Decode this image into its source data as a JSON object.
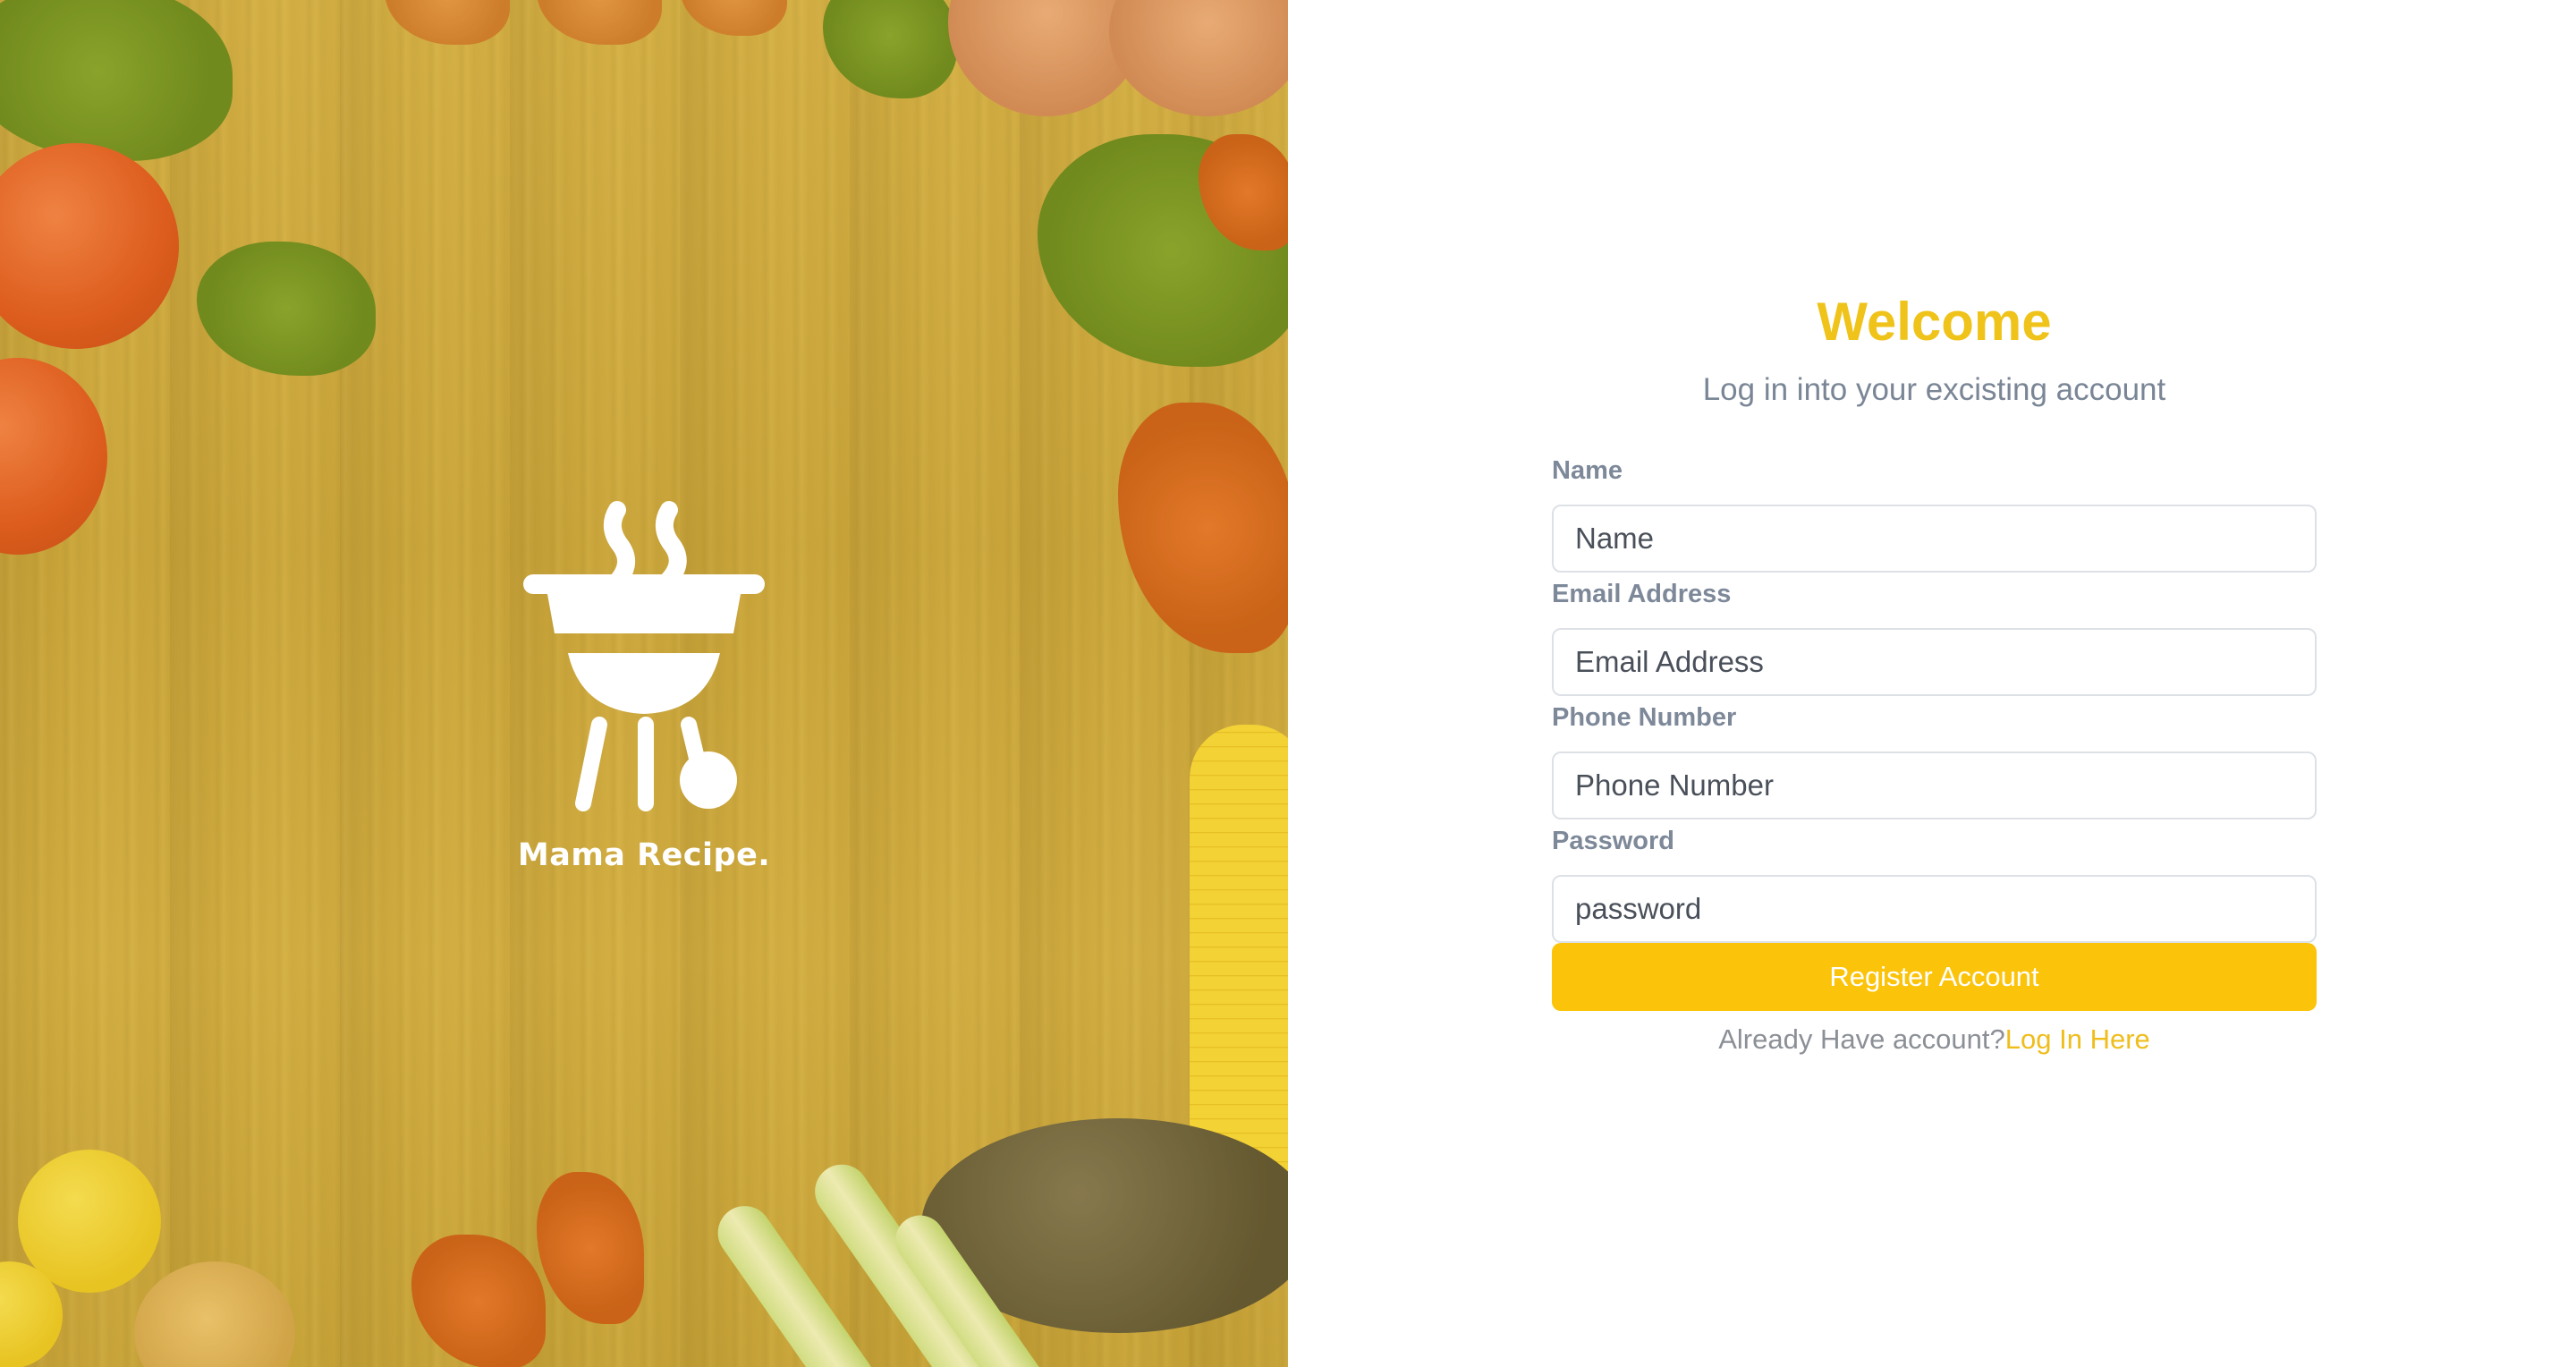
{
  "brand": {
    "name": "Mama Recipe.",
    "icon": "grill-icon"
  },
  "form": {
    "title": "Welcome",
    "subtitle": "Log in into your excisting account",
    "fields": [
      {
        "label": "Name",
        "placeholder": "Name"
      },
      {
        "label": "Email Address",
        "placeholder": "Email Address"
      },
      {
        "label": "Phone Number",
        "placeholder": "Phone Number"
      },
      {
        "label": "Password",
        "placeholder": "password"
      }
    ],
    "submit_label": "Register Account",
    "footer_text": "Already Have account?",
    "footer_link": "Log In Here"
  },
  "colors": {
    "accent": "#fbc30a",
    "title": "#efc31a",
    "muted": "#7d8899"
  }
}
